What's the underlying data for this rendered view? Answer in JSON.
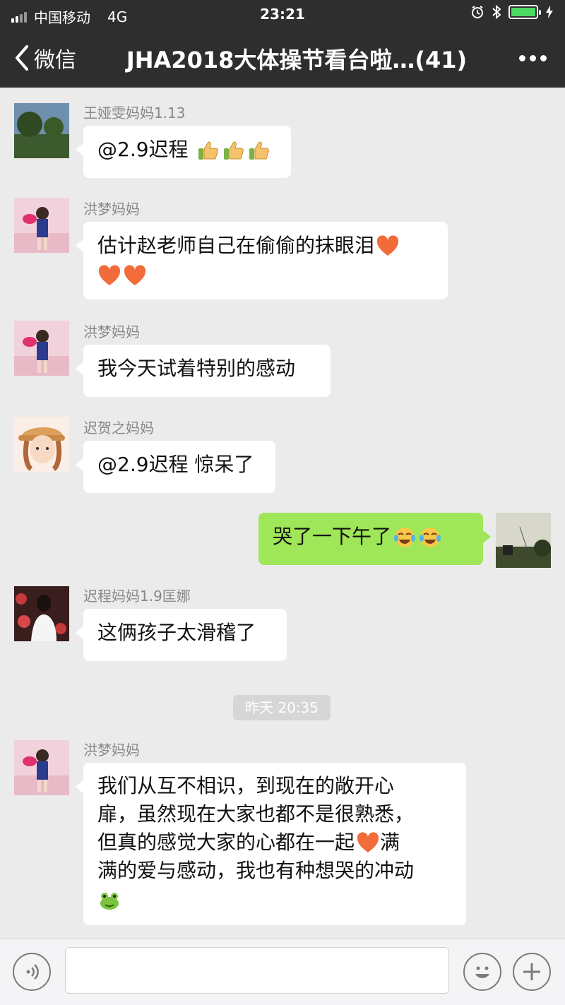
{
  "status_bar": {
    "carrier": "中国移动",
    "network": "4G",
    "time": "23:21"
  },
  "nav": {
    "back_label": "微信",
    "title": "JHA2018大体操节看台啦…(41)"
  },
  "messages": [
    {
      "sender": "王娅雯妈妈1.13",
      "text": "@2.9迟程",
      "emoji": [
        "thumbs-up",
        "thumbs-up",
        "thumbs-up"
      ]
    },
    {
      "sender": "洪梦妈妈",
      "line1": "估计赵老师自己在偷偷的抹眼泪",
      "emoji": [
        "heart",
        "heart",
        "heart"
      ]
    },
    {
      "sender": "洪梦妈妈",
      "text": "我今天试着特别的感动"
    },
    {
      "sender": "迟贺之妈妈",
      "text": "@2.9迟程 惊呆了"
    },
    {
      "sender": "",
      "text": "哭了一下午了",
      "emoji": [
        "tears-of-joy",
        "tears-of-joy"
      ],
      "outgoing": true
    },
    {
      "sender": "迟程妈妈1.9匡娜",
      "text": "这俩孩子太滑稽了"
    },
    {
      "sender": "洪梦妈妈",
      "lines": [
        "我们从互不相识，到现在的敞开心",
        "扉，虽然现在大家也都不是很熟悉，",
        "但真的感觉大家的心都在一起",
        "满的爱与感动，我也有种想哭的冲动"
      ],
      "line3_tail": "满",
      "line4_head": "满",
      "emoji": [
        "heart",
        "frog"
      ]
    }
  ],
  "time_stamp": "昨天 20:35",
  "icons": {
    "back": "chevron-left-icon",
    "more": "more-dots-icon",
    "voice": "voice-icon",
    "emoji": "emoji-icon",
    "add": "plus-icon"
  },
  "colors": {
    "header": "#2e2e2e",
    "chat_bg": "#ebebeb",
    "outgoing_bubble": "#9fe658",
    "incoming_bubble": "#ffffff"
  }
}
